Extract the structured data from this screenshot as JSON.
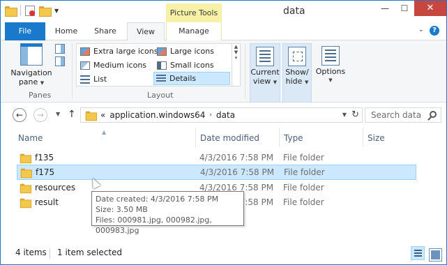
{
  "window": {
    "title": "data"
  },
  "contextual_tab_header": "Picture Tools",
  "tabs": [
    {
      "label": "File"
    },
    {
      "label": "Home"
    },
    {
      "label": "Share"
    },
    {
      "label": "View"
    },
    {
      "label": "Manage"
    }
  ],
  "ribbon": {
    "panes": {
      "navigation_pane_label_1": "Navigation",
      "navigation_pane_label_2": "pane",
      "group_label": "Panes"
    },
    "layout": {
      "group_label": "Layout",
      "items": [
        {
          "label": "Extra large icons"
        },
        {
          "label": "Large icons"
        },
        {
          "label": "Medium icons"
        },
        {
          "label": "Small icons"
        },
        {
          "label": "List"
        },
        {
          "label": "Details"
        }
      ],
      "selected": "Details"
    },
    "current_view": {
      "label_1": "Current",
      "label_2": "view"
    },
    "show_hide": {
      "label_1": "Show/",
      "label_2": "hide"
    },
    "options": {
      "label": "Options"
    }
  },
  "address": {
    "prefix": "«",
    "crumbs": [
      "application.windows64",
      "data"
    ],
    "search_placeholder": "Search data"
  },
  "columns": [
    "Name",
    "Date modified",
    "Type",
    "Size"
  ],
  "files": [
    {
      "name": "f135",
      "date": "4/3/2016 7:58 PM",
      "type": "File folder"
    },
    {
      "name": "f175",
      "date": "4/3/2016 7:58 PM",
      "type": "File folder"
    },
    {
      "name": "resources",
      "date": "4/3/2016 7:58 PM",
      "type": "File folder"
    },
    {
      "name": "result",
      "date": "4/3/2016 7:58 PM",
      "type": "File folder"
    }
  ],
  "selected_file": "f175",
  "tooltip": {
    "line1": "Date created: 4/3/2016 7:58 PM",
    "line2": "Size: 3.50 MB",
    "line3": "Files: 000981.jpg, 000982.jpg, 000983.jpg"
  },
  "status": {
    "item_count": "4 items",
    "selection": "1 item selected"
  },
  "colors": {
    "accent": "#1979ca",
    "selection": "#cce8ff",
    "context_tab": "#f6f1a6",
    "close_button": "#c7463f"
  }
}
